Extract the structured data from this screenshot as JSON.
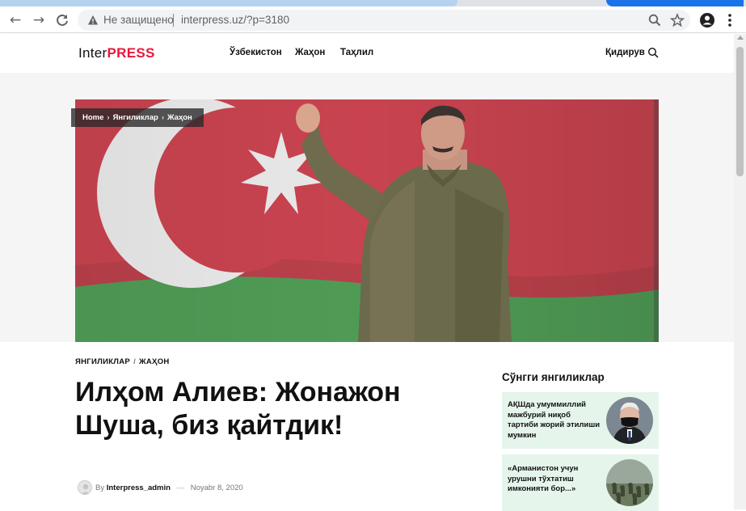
{
  "browser": {
    "security_label": "Не защищено",
    "url": "interpress.uz/?p=3180"
  },
  "site": {
    "logo_inter": "Inter",
    "logo_press": "PRESS",
    "menu": [
      "Ўзбекистон",
      "Жаҳон",
      "Таҳлил"
    ],
    "search_label": "Қидирув"
  },
  "breadcrumb": {
    "home": "Home",
    "cat": "Янгиликлар",
    "sub": "Жаҳон"
  },
  "article": {
    "category_1": "ЯНГИЛИКЛАР",
    "category_2": "ЖАҲОН",
    "title": "Илҳом Алиев: Жонажон Шуша, биз қайтдик!",
    "by": "By",
    "author": "Interpress_admin",
    "date": "Noyabr 8, 2020"
  },
  "sidebar": {
    "title": "Сўнгги янгиликлар",
    "items": [
      {
        "text": "АҚШда умуммиллий мажбурий ниқоб тартиби жорий этилиши мумкин"
      },
      {
        "text": "«Арманистон учун урушни тўхтатиш имконияти бор...»"
      }
    ]
  },
  "colors": {
    "brand_red": "#e8173c",
    "card_bg": "#e6f5ec",
    "flag_red": "#c7424f",
    "flag_green": "#4f9b55"
  }
}
